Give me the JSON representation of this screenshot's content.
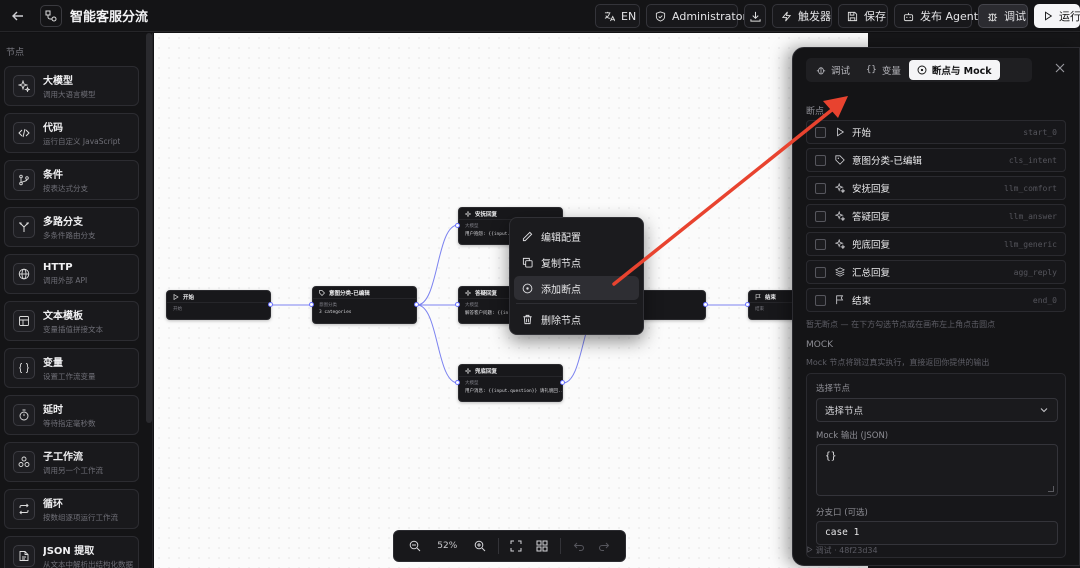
{
  "header": {
    "title": "智能客服分流",
    "lang_label": "EN",
    "role_label": "Administrator",
    "trigger_label": "触发器",
    "save_label": "保存",
    "publish_label": "发布 Agent",
    "debug_label": "调试",
    "run_label": "运行"
  },
  "sidebar": {
    "title": "节点",
    "items": [
      {
        "title": "大模型",
        "desc": "调用大语言模型",
        "icon": "sparkles-icon"
      },
      {
        "title": "代码",
        "desc": "运行自定义 JavaScript",
        "icon": "code-icon"
      },
      {
        "title": "条件",
        "desc": "按表达式分支",
        "icon": "git-branch-icon"
      },
      {
        "title": "多路分支",
        "desc": "多条件路由分支",
        "icon": "split-icon"
      },
      {
        "title": "HTTP",
        "desc": "调用外部 API",
        "icon": "globe-icon"
      },
      {
        "title": "文本模板",
        "desc": "变量插值拼接文本",
        "icon": "template-icon"
      },
      {
        "title": "变量",
        "desc": "设置工作流变量",
        "icon": "braces-icon"
      },
      {
        "title": "延时",
        "desc": "等待指定毫秒数",
        "icon": "timer-icon"
      },
      {
        "title": "子工作流",
        "desc": "调用另一个工作流",
        "icon": "workflow-icon"
      },
      {
        "title": "循环",
        "desc": "按数组逐项运行工作流",
        "icon": "repeat-icon"
      },
      {
        "title": "JSON 提取",
        "desc": "从文本中解析出结构化数据",
        "icon": "json-icon"
      }
    ]
  },
  "canvas": {
    "nodes": {
      "start": {
        "title": "开始",
        "label": "开始"
      },
      "intent": {
        "title": "意图分类-已编辑",
        "label": "意图分类",
        "body": "3 categories"
      },
      "comfort": {
        "title": "安抚回复",
        "label": "大模型",
        "body": "用户抱怨: {{input.q"
      },
      "answer": {
        "title": "答疑回复",
        "label": "大模型",
        "body": "解答客户问题: {{in"
      },
      "generic": {
        "title": "兜底回复",
        "label": "大模型",
        "body": "用户消息: {{input.question}} 请礼貌回..."
      },
      "end": {
        "title": "结束",
        "label": "结束"
      }
    },
    "context_menu": {
      "items": [
        "编辑配置",
        "复制节点",
        "添加断点",
        "删除节点"
      ]
    }
  },
  "toolbar": {
    "zoom": "52%"
  },
  "panel": {
    "tabs": [
      "调试",
      "变量",
      "断点与 Mock"
    ],
    "active_tab": "断点与 Mock",
    "breakpoints_title": "断点",
    "breakpoints": [
      {
        "name": "开始",
        "id": "start_0",
        "icon": "play-icon"
      },
      {
        "name": "意图分类-已编辑",
        "id": "cls_intent",
        "icon": "tag-icon"
      },
      {
        "name": "安抚回复",
        "id": "llm_comfort",
        "icon": "sparkles-icon"
      },
      {
        "name": "答疑回复",
        "id": "llm_answer",
        "icon": "sparkles-icon"
      },
      {
        "name": "兜底回复",
        "id": "llm_generic",
        "icon": "sparkles-icon"
      },
      {
        "name": "汇总回复",
        "id": "agg_reply",
        "icon": "layers-icon"
      },
      {
        "name": "结束",
        "id": "end_0",
        "icon": "flag-icon"
      }
    ],
    "breakpoints_hint": "暂无断点 — 在下方勾选节点或在画布左上角点击圆点",
    "mock_title": "MOCK",
    "mock_hint": "Mock 节点将跳过真实执行，直接返回你提供的输出",
    "select_label": "选择节点",
    "select_value": "选择节点",
    "mock_output_label": "Mock 输出 (JSON)",
    "mock_output_value": "{}",
    "branch_label": "分支口 (可选)",
    "branch_value": "case 1",
    "footer": "调试 · 48f23d34"
  }
}
